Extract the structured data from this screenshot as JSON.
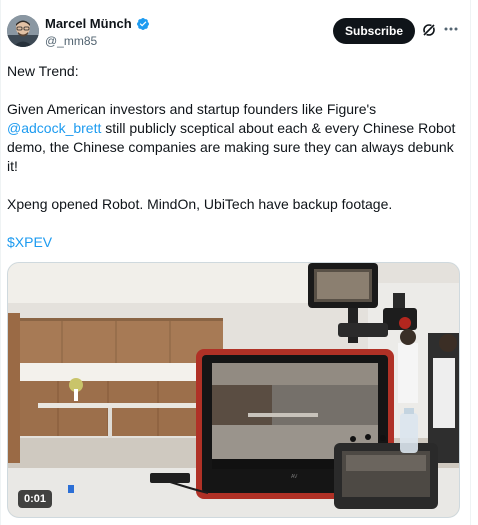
{
  "author": {
    "name": "Marcel Münch",
    "handle": "@_mm85",
    "verified": true,
    "verified_color": "#1d9bf0"
  },
  "actions": {
    "subscribe_label": "Subscribe",
    "grok_icon": "grok-icon",
    "more_icon": "more-horizontal-icon"
  },
  "tweet": {
    "line1": "New Trend:",
    "para2_before": "Given American investors and startup founders like Figure's ",
    "mention": "@adcock_brett",
    "para2_after": " still publicly sceptical about each & every Chinese Robot demo, the Chinese companies are making sure they can always debunk it!",
    "para3": "Xpeng opened Robot. MindOn, UbiTech have backup footage.",
    "cashtag": "$XPEV",
    "link_color": "#1d9bf0"
  },
  "media": {
    "type": "video",
    "timestamp": "0:01"
  }
}
